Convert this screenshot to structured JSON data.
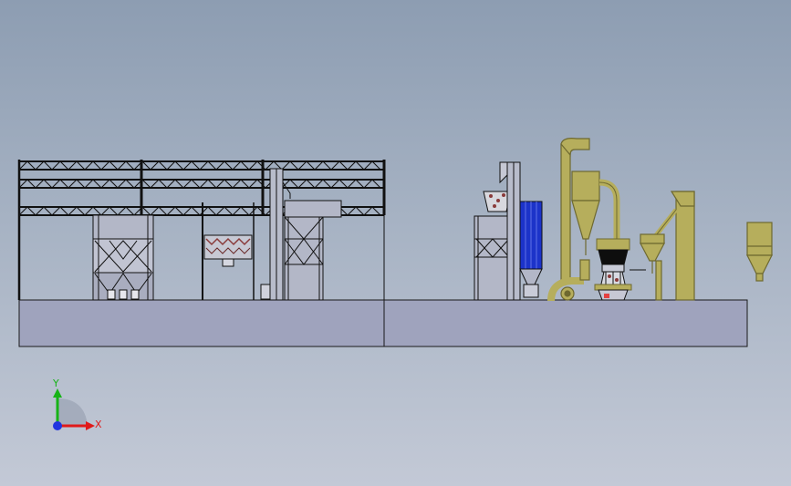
{
  "viewport": {
    "background_top": "#8d9db2",
    "background_bottom": "#c3c9d6"
  },
  "colors": {
    "line": "#1a1a1a",
    "floor_fill": "#9fa3bd",
    "equipment_olive": "#b6ae5c",
    "equipment_olive_dark": "#6e6930",
    "hopper_grey": "#b3b7c7",
    "bag_filter_blue": "#1c33c9",
    "axis_x": "#e01a1a",
    "axis_y": "#17b317",
    "axis_z": "#2035e0"
  },
  "triad": {
    "x_label": "X",
    "y_label": "Y",
    "x_color": "#e01a1a",
    "y_color": "#17b317",
    "z_color": "#2035e0"
  },
  "model": {
    "platforms": [
      "left-platform",
      "right-platform"
    ],
    "equipment": [
      "steel-frame-structure",
      "silo-left",
      "screw-conveyor-hopper",
      "bucket-elevator-left",
      "silo-right",
      "feed-bin",
      "bucket-elevator-right",
      "bag-filter",
      "cyclone-collector",
      "grinding-mill",
      "product-elevator",
      "standalone-hopper"
    ]
  }
}
